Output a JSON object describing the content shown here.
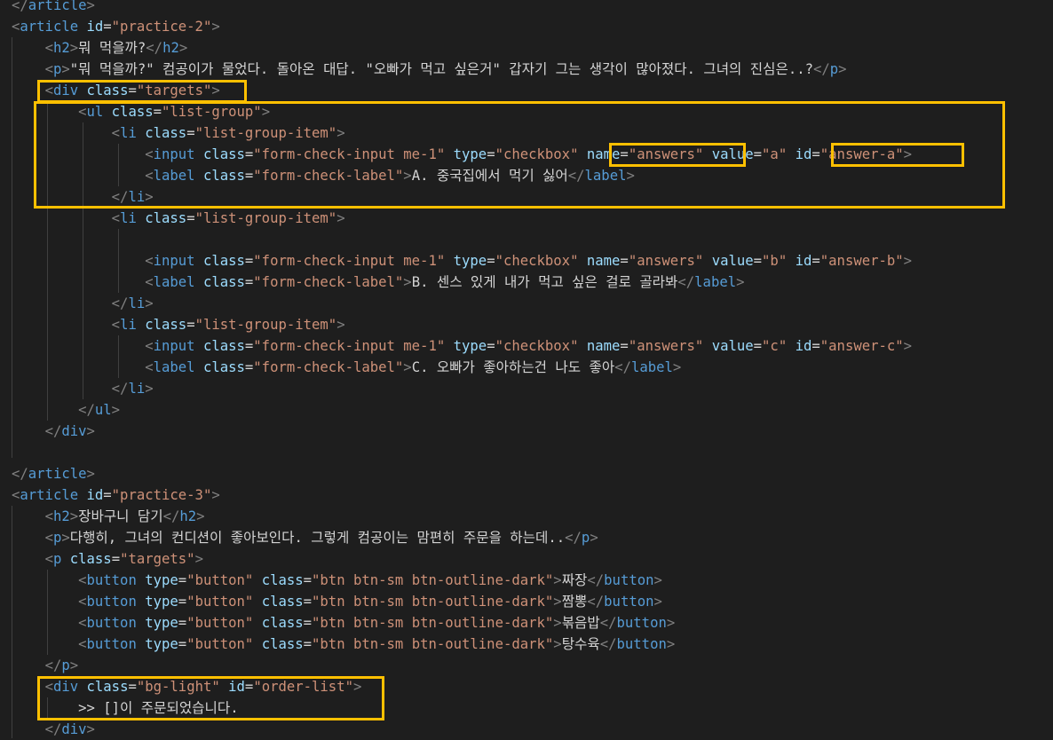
{
  "colors": {
    "background": "#1e1e1e",
    "tag_bracket": "#808080",
    "tag_name": "#569cd6",
    "attribute": "#9cdcfe",
    "string": "#ce9178",
    "text": "#d4d4d4",
    "highlight": "#ffc000"
  },
  "lines": [
    [
      [
        "p",
        "</"
      ],
      [
        "g",
        "article"
      ],
      [
        "p",
        ">"
      ]
    ],
    [
      [
        "p",
        "<"
      ],
      [
        "g",
        "article"
      ],
      [
        "x",
        " "
      ],
      [
        "a",
        "id"
      ],
      [
        "e",
        "="
      ],
      [
        "s",
        "\"practice-2\""
      ],
      [
        "p",
        ">"
      ]
    ],
    [
      [
        "x",
        "    "
      ],
      [
        "p",
        "<"
      ],
      [
        "g",
        "h2"
      ],
      [
        "p",
        ">"
      ],
      [
        "x",
        "뭐 먹을까?"
      ],
      [
        "p",
        "</"
      ],
      [
        "g",
        "h2"
      ],
      [
        "p",
        ">"
      ]
    ],
    [
      [
        "x",
        "    "
      ],
      [
        "p",
        "<"
      ],
      [
        "g",
        "p"
      ],
      [
        "p",
        ">"
      ],
      [
        "x",
        "\"뭐 먹을까?\" 컴공이가 물었다. 돌아온 대답. \"오빠가 먹고 싶은거\" 갑자기 그는 생각이 많아졌다. 그녀의 진심은..?"
      ],
      [
        "p",
        "</"
      ],
      [
        "g",
        "p"
      ],
      [
        "p",
        ">"
      ]
    ],
    [
      [
        "x",
        "    "
      ],
      [
        "p",
        "<"
      ],
      [
        "g",
        "div"
      ],
      [
        "x",
        " "
      ],
      [
        "a",
        "class"
      ],
      [
        "e",
        "="
      ],
      [
        "s",
        "\"targets\""
      ],
      [
        "p",
        ">"
      ]
    ],
    [
      [
        "x",
        "        "
      ],
      [
        "p",
        "<"
      ],
      [
        "g",
        "ul"
      ],
      [
        "x",
        " "
      ],
      [
        "a",
        "class"
      ],
      [
        "e",
        "="
      ],
      [
        "s",
        "\"list-group\""
      ],
      [
        "p",
        ">"
      ]
    ],
    [
      [
        "x",
        "            "
      ],
      [
        "p",
        "<"
      ],
      [
        "g",
        "li"
      ],
      [
        "x",
        " "
      ],
      [
        "a",
        "class"
      ],
      [
        "e",
        "="
      ],
      [
        "s",
        "\"list-group-item\""
      ],
      [
        "p",
        ">"
      ]
    ],
    [
      [
        "x",
        "                "
      ],
      [
        "p",
        "<"
      ],
      [
        "g",
        "input"
      ],
      [
        "x",
        " "
      ],
      [
        "a",
        "class"
      ],
      [
        "e",
        "="
      ],
      [
        "s",
        "\"form-check-input me-1\""
      ],
      [
        "x",
        " "
      ],
      [
        "a",
        "type"
      ],
      [
        "e",
        "="
      ],
      [
        "s",
        "\"checkbox\""
      ],
      [
        "x",
        " "
      ],
      [
        "a",
        "name"
      ],
      [
        "e",
        "="
      ],
      [
        "s",
        "\"answers\""
      ],
      [
        "x",
        " "
      ],
      [
        "a",
        "value"
      ],
      [
        "e",
        "="
      ],
      [
        "s",
        "\"a\""
      ],
      [
        "x",
        " "
      ],
      [
        "a",
        "id"
      ],
      [
        "e",
        "="
      ],
      [
        "s",
        "\"answer-a\""
      ],
      [
        "p",
        ">"
      ]
    ],
    [
      [
        "x",
        "                "
      ],
      [
        "p",
        "<"
      ],
      [
        "g",
        "label"
      ],
      [
        "x",
        " "
      ],
      [
        "a",
        "class"
      ],
      [
        "e",
        "="
      ],
      [
        "s",
        "\"form-check-label\""
      ],
      [
        "p",
        ">"
      ],
      [
        "x",
        "A. 중국집에서 먹기 싫어"
      ],
      [
        "p",
        "</"
      ],
      [
        "g",
        "label"
      ],
      [
        "p",
        ">"
      ]
    ],
    [
      [
        "x",
        "            "
      ],
      [
        "p",
        "</"
      ],
      [
        "g",
        "li"
      ],
      [
        "p",
        ">"
      ]
    ],
    [
      [
        "x",
        "            "
      ],
      [
        "p",
        "<"
      ],
      [
        "g",
        "li"
      ],
      [
        "x",
        " "
      ],
      [
        "a",
        "class"
      ],
      [
        "e",
        "="
      ],
      [
        "s",
        "\"list-group-item\""
      ],
      [
        "p",
        ">"
      ]
    ],
    [],
    [
      [
        "x",
        "                "
      ],
      [
        "p",
        "<"
      ],
      [
        "g",
        "input"
      ],
      [
        "x",
        " "
      ],
      [
        "a",
        "class"
      ],
      [
        "e",
        "="
      ],
      [
        "s",
        "\"form-check-input me-1\""
      ],
      [
        "x",
        " "
      ],
      [
        "a",
        "type"
      ],
      [
        "e",
        "="
      ],
      [
        "s",
        "\"checkbox\""
      ],
      [
        "x",
        " "
      ],
      [
        "a",
        "name"
      ],
      [
        "e",
        "="
      ],
      [
        "s",
        "\"answers\""
      ],
      [
        "x",
        " "
      ],
      [
        "a",
        "value"
      ],
      [
        "e",
        "="
      ],
      [
        "s",
        "\"b\""
      ],
      [
        "x",
        " "
      ],
      [
        "a",
        "id"
      ],
      [
        "e",
        "="
      ],
      [
        "s",
        "\"answer-b\""
      ],
      [
        "p",
        ">"
      ]
    ],
    [
      [
        "x",
        "                "
      ],
      [
        "p",
        "<"
      ],
      [
        "g",
        "label"
      ],
      [
        "x",
        " "
      ],
      [
        "a",
        "class"
      ],
      [
        "e",
        "="
      ],
      [
        "s",
        "\"form-check-label\""
      ],
      [
        "p",
        ">"
      ],
      [
        "x",
        "B. 센스 있게 내가 먹고 싶은 걸로 골라봐"
      ],
      [
        "p",
        "</"
      ],
      [
        "g",
        "label"
      ],
      [
        "p",
        ">"
      ]
    ],
    [
      [
        "x",
        "            "
      ],
      [
        "p",
        "</"
      ],
      [
        "g",
        "li"
      ],
      [
        "p",
        ">"
      ]
    ],
    [
      [
        "x",
        "            "
      ],
      [
        "p",
        "<"
      ],
      [
        "g",
        "li"
      ],
      [
        "x",
        " "
      ],
      [
        "a",
        "class"
      ],
      [
        "e",
        "="
      ],
      [
        "s",
        "\"list-group-item\""
      ],
      [
        "p",
        ">"
      ]
    ],
    [
      [
        "x",
        "                "
      ],
      [
        "p",
        "<"
      ],
      [
        "g",
        "input"
      ],
      [
        "x",
        " "
      ],
      [
        "a",
        "class"
      ],
      [
        "e",
        "="
      ],
      [
        "s",
        "\"form-check-input me-1\""
      ],
      [
        "x",
        " "
      ],
      [
        "a",
        "type"
      ],
      [
        "e",
        "="
      ],
      [
        "s",
        "\"checkbox\""
      ],
      [
        "x",
        " "
      ],
      [
        "a",
        "name"
      ],
      [
        "e",
        "="
      ],
      [
        "s",
        "\"answers\""
      ],
      [
        "x",
        " "
      ],
      [
        "a",
        "value"
      ],
      [
        "e",
        "="
      ],
      [
        "s",
        "\"c\""
      ],
      [
        "x",
        " "
      ],
      [
        "a",
        "id"
      ],
      [
        "e",
        "="
      ],
      [
        "s",
        "\"answer-c\""
      ],
      [
        "p",
        ">"
      ]
    ],
    [
      [
        "x",
        "                "
      ],
      [
        "p",
        "<"
      ],
      [
        "g",
        "label"
      ],
      [
        "x",
        " "
      ],
      [
        "a",
        "class"
      ],
      [
        "e",
        "="
      ],
      [
        "s",
        "\"form-check-label\""
      ],
      [
        "p",
        ">"
      ],
      [
        "x",
        "C. 오빠가 좋아하는건 나도 좋아"
      ],
      [
        "p",
        "</"
      ],
      [
        "g",
        "label"
      ],
      [
        "p",
        ">"
      ]
    ],
    [
      [
        "x",
        "            "
      ],
      [
        "p",
        "</"
      ],
      [
        "g",
        "li"
      ],
      [
        "p",
        ">"
      ]
    ],
    [
      [
        "x",
        "        "
      ],
      [
        "p",
        "</"
      ],
      [
        "g",
        "ul"
      ],
      [
        "p",
        ">"
      ]
    ],
    [
      [
        "x",
        "    "
      ],
      [
        "p",
        "</"
      ],
      [
        "g",
        "div"
      ],
      [
        "p",
        ">"
      ]
    ],
    [],
    [
      [
        "p",
        "</"
      ],
      [
        "g",
        "article"
      ],
      [
        "p",
        ">"
      ]
    ],
    [
      [
        "p",
        "<"
      ],
      [
        "g",
        "article"
      ],
      [
        "x",
        " "
      ],
      [
        "a",
        "id"
      ],
      [
        "e",
        "="
      ],
      [
        "s",
        "\"practice-3\""
      ],
      [
        "p",
        ">"
      ]
    ],
    [
      [
        "x",
        "    "
      ],
      [
        "p",
        "<"
      ],
      [
        "g",
        "h2"
      ],
      [
        "p",
        ">"
      ],
      [
        "x",
        "장바구니 담기"
      ],
      [
        "p",
        "</"
      ],
      [
        "g",
        "h2"
      ],
      [
        "p",
        ">"
      ]
    ],
    [
      [
        "x",
        "    "
      ],
      [
        "p",
        "<"
      ],
      [
        "g",
        "p"
      ],
      [
        "p",
        ">"
      ],
      [
        "x",
        "다행히, 그녀의 컨디션이 좋아보인다. 그렇게 컴공이는 맘편히 주문을 하는데.."
      ],
      [
        "p",
        "</"
      ],
      [
        "g",
        "p"
      ],
      [
        "p",
        ">"
      ]
    ],
    [
      [
        "x",
        "    "
      ],
      [
        "p",
        "<"
      ],
      [
        "g",
        "p"
      ],
      [
        "x",
        " "
      ],
      [
        "a",
        "class"
      ],
      [
        "e",
        "="
      ],
      [
        "s",
        "\"targets\""
      ],
      [
        "p",
        ">"
      ]
    ],
    [
      [
        "x",
        "        "
      ],
      [
        "p",
        "<"
      ],
      [
        "g",
        "button"
      ],
      [
        "x",
        " "
      ],
      [
        "a",
        "type"
      ],
      [
        "e",
        "="
      ],
      [
        "s",
        "\"button\""
      ],
      [
        "x",
        " "
      ],
      [
        "a",
        "class"
      ],
      [
        "e",
        "="
      ],
      [
        "s",
        "\"btn btn-sm btn-outline-dark\""
      ],
      [
        "p",
        ">"
      ],
      [
        "x",
        "짜장"
      ],
      [
        "p",
        "</"
      ],
      [
        "g",
        "button"
      ],
      [
        "p",
        ">"
      ]
    ],
    [
      [
        "x",
        "        "
      ],
      [
        "p",
        "<"
      ],
      [
        "g",
        "button"
      ],
      [
        "x",
        " "
      ],
      [
        "a",
        "type"
      ],
      [
        "e",
        "="
      ],
      [
        "s",
        "\"button\""
      ],
      [
        "x",
        " "
      ],
      [
        "a",
        "class"
      ],
      [
        "e",
        "="
      ],
      [
        "s",
        "\"btn btn-sm btn-outline-dark\""
      ],
      [
        "p",
        ">"
      ],
      [
        "x",
        "짬뽕"
      ],
      [
        "p",
        "</"
      ],
      [
        "g",
        "button"
      ],
      [
        "p",
        ">"
      ]
    ],
    [
      [
        "x",
        "        "
      ],
      [
        "p",
        "<"
      ],
      [
        "g",
        "button"
      ],
      [
        "x",
        " "
      ],
      [
        "a",
        "type"
      ],
      [
        "e",
        "="
      ],
      [
        "s",
        "\"button\""
      ],
      [
        "x",
        " "
      ],
      [
        "a",
        "class"
      ],
      [
        "e",
        "="
      ],
      [
        "s",
        "\"btn btn-sm btn-outline-dark\""
      ],
      [
        "p",
        ">"
      ],
      [
        "x",
        "볶음밥"
      ],
      [
        "p",
        "</"
      ],
      [
        "g",
        "button"
      ],
      [
        "p",
        ">"
      ]
    ],
    [
      [
        "x",
        "        "
      ],
      [
        "p",
        "<"
      ],
      [
        "g",
        "button"
      ],
      [
        "x",
        " "
      ],
      [
        "a",
        "type"
      ],
      [
        "e",
        "="
      ],
      [
        "s",
        "\"button\""
      ],
      [
        "x",
        " "
      ],
      [
        "a",
        "class"
      ],
      [
        "e",
        "="
      ],
      [
        "s",
        "\"btn btn-sm btn-outline-dark\""
      ],
      [
        "p",
        ">"
      ],
      [
        "x",
        "탕수육"
      ],
      [
        "p",
        "</"
      ],
      [
        "g",
        "button"
      ],
      [
        "p",
        ">"
      ]
    ],
    [
      [
        "x",
        "    "
      ],
      [
        "p",
        "</"
      ],
      [
        "g",
        "p"
      ],
      [
        "p",
        ">"
      ]
    ],
    [
      [
        "x",
        "    "
      ],
      [
        "p",
        "<"
      ],
      [
        "g",
        "div"
      ],
      [
        "x",
        " "
      ],
      [
        "a",
        "class"
      ],
      [
        "e",
        "="
      ],
      [
        "s",
        "\"bg-light\""
      ],
      [
        "x",
        " "
      ],
      [
        "a",
        "id"
      ],
      [
        "e",
        "="
      ],
      [
        "s",
        "\"order-list\""
      ],
      [
        "p",
        ">"
      ]
    ],
    [
      [
        "x",
        "        >> []이 주문되었습니다."
      ]
    ],
    [
      [
        "x",
        "    "
      ],
      [
        "p",
        "</"
      ],
      [
        "g",
        "div"
      ],
      [
        "p",
        ">"
      ]
    ]
  ]
}
